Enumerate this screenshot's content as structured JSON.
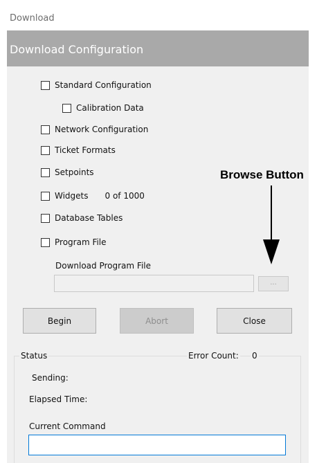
{
  "window": {
    "title": "Download",
    "header": "Download Configuration"
  },
  "options": {
    "standard_configuration": "Standard Configuration",
    "calibration_data": "Calibration Data",
    "network_configuration": "Network Configuration",
    "ticket_formats": "Ticket Formats",
    "setpoints": "Setpoints",
    "widgets": "Widgets",
    "widgets_count": "0 of 1000",
    "database_tables": "Database Tables",
    "program_file": "Program File"
  },
  "download_program_file": {
    "label": "Download Program File",
    "value": "",
    "browse_label": "..."
  },
  "buttons": {
    "begin": "Begin",
    "abort": "Abort",
    "close": "Close"
  },
  "status": {
    "title": "Status",
    "error_count_label": "Error Count:",
    "error_count": "0",
    "sending_label": "Sending:",
    "elapsed_label": "Elapsed Time:",
    "current_command_label": "Current Command",
    "current_command_value": ""
  },
  "annotation": {
    "text": "Browse Button"
  }
}
